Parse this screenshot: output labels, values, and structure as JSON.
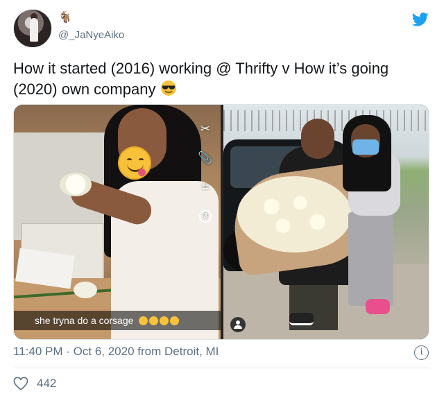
{
  "user": {
    "handle": "@_JaNyeAiko",
    "name_icon": "goat-emoji"
  },
  "brand": {
    "icon": "twitter-bird-icon",
    "color": "#1da1f2"
  },
  "tweet": {
    "text": "How it started (2016) working @ Thrifty v How it’s going (2020) own company",
    "emoji": "sunglasses-emoji"
  },
  "media": {
    "left_photo": {
      "caption": "she tryna do a corsage",
      "caption_emojis": "grimacing-emoji x4",
      "tools": [
        "scissors-icon",
        "paperclip-icon",
        "crop-icon",
        "timer-icon"
      ],
      "timer_value": "3"
    },
    "right_photo": {
      "badge_icon": "person-icon"
    }
  },
  "meta": {
    "time": "11:40 PM",
    "separator": "·",
    "date": "Oct 6, 2020",
    "location": "from Detroit, MI"
  },
  "engagement": {
    "likes": "442"
  },
  "colors": {
    "secondary_text": "#5b7083",
    "primary_text": "#14171a"
  }
}
